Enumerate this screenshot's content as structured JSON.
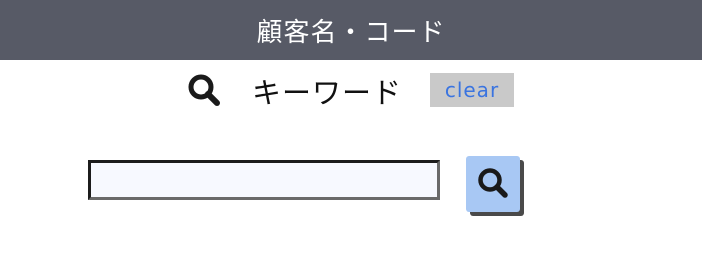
{
  "header": {
    "title": "顧客名・コード"
  },
  "keyword": {
    "icon": "search-icon",
    "label": "キーワード",
    "clear_label": "clear"
  },
  "search": {
    "value": "",
    "placeholder": "",
    "button_icon": "search-icon"
  },
  "colors": {
    "header_bg": "#575a66",
    "header_text": "#ffffff",
    "clear_bg": "#c9c9c9",
    "clear_text": "#3a74e0",
    "search_button_bg": "#a8c8f4",
    "input_bg": "#f7f9ff"
  }
}
